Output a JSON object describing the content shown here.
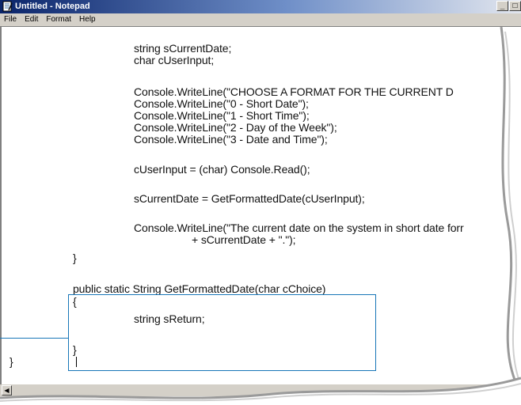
{
  "window": {
    "title": "Untitled - Notepad",
    "controls": {
      "minimize": "_",
      "maximize": "□"
    }
  },
  "menu": {
    "items": [
      "File",
      "Edit",
      "Format",
      "Help"
    ]
  },
  "editor": {
    "lines": [
      "string sCurrentDate;",
      "char cUserInput;",
      "Console.WriteLine(\"CHOOSE A FORMAT FOR THE CURRENT D",
      "Console.WriteLine(\"0 - Short Date\");",
      "Console.WriteLine(\"1 - Short Time\");",
      "Console.WriteLine(\"2 - Day of the Week\");",
      "Console.WriteLine(\"3 - Date and Time\");",
      "cUserInput = (char) Console.Read();",
      "sCurrentDate = GetFormattedDate(cUserInput);",
      "Console.WriteLine(\"The current date on the system in short date forr",
      "+ sCurrentDate + \".\");",
      "}",
      "public static String GetFormattedDate(char cChoice)",
      "{",
      "string sReturn;",
      "}",
      "}"
    ]
  },
  "scrollbar": {
    "left_arrow": "◀"
  }
}
